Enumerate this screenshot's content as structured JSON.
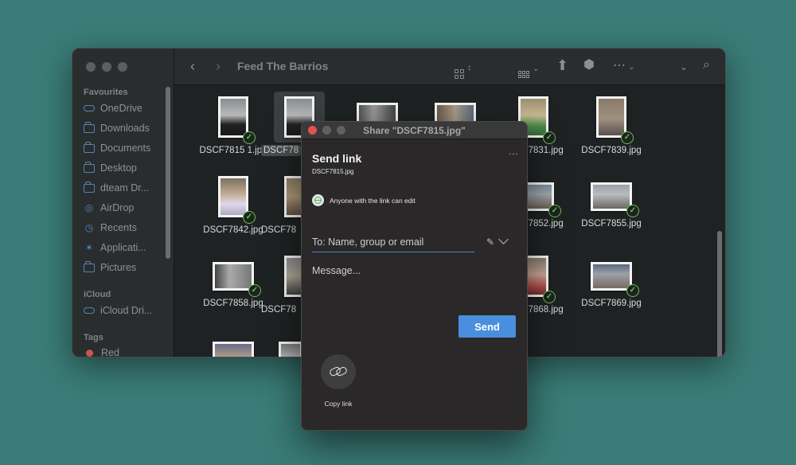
{
  "finder": {
    "title": "Feed The Barrios",
    "sidebar": {
      "favourites_label": "Favourites",
      "items": [
        {
          "label": "OneDrive",
          "icon": "cloud-icon"
        },
        {
          "label": "Downloads",
          "icon": "folder-icon"
        },
        {
          "label": "Documents",
          "icon": "folder-icon"
        },
        {
          "label": "Desktop",
          "icon": "folder-icon"
        },
        {
          "label": "dteam Dr...",
          "icon": "folder-icon"
        },
        {
          "label": "AirDrop",
          "icon": "airdrop-icon"
        },
        {
          "label": "Recents",
          "icon": "clock-icon"
        },
        {
          "label": "Applicati...",
          "icon": "applications-icon"
        },
        {
          "label": "Pictures",
          "icon": "folder-icon"
        }
      ],
      "icloud_label": "iCloud",
      "icloud_items": [
        {
          "label": "iCloud Dri...",
          "icon": "cloud-icon"
        }
      ],
      "tags_label": "Tags",
      "tag_items": [
        {
          "label": "Red",
          "color": "#c9574c"
        }
      ]
    },
    "files": [
      {
        "name": "DSCF7815 1.jpg"
      },
      {
        "name": "DSCF78"
      },
      {
        "name": ""
      },
      {
        "name": ""
      },
      {
        "name": "DSCF7831.jpg"
      },
      {
        "name": "DSCF7839.jpg"
      },
      {
        "name": "DSCF7842.jpg"
      },
      {
        "name": "DSCF78"
      },
      {
        "name": "DSCF7852.jpg"
      },
      {
        "name": "DSCF7855.jpg"
      },
      {
        "name": "DSCF7858.jpg"
      },
      {
        "name": "DSCF78"
      },
      {
        "name": "DSCF7868.jpg"
      },
      {
        "name": "DSCF7869.jpg"
      }
    ]
  },
  "share": {
    "window_title": "Share \"DSCF7815.jpg\"",
    "heading": "Send link",
    "file_name": "DSCF7815.jpg",
    "permission": "Anyone with the link can edit",
    "to_placeholder": "To: Name, group or email",
    "message_placeholder": "Message...",
    "send_label": "Send",
    "copy_link_label": "Copy link",
    "more_label": "...",
    "accent_color": "#4a8fde"
  }
}
